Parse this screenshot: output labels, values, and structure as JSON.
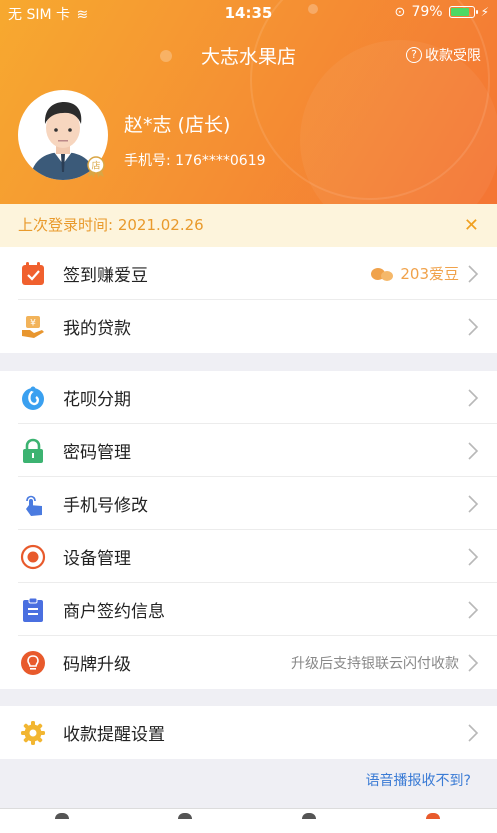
{
  "status_bar": {
    "carrier": "无 SIM 卡",
    "time": "14:35",
    "battery": "79%"
  },
  "header": {
    "title": "大志水果店",
    "limit_link": "收款受限",
    "user_name": "赵*志 (店长)",
    "user_phone": "手机号: 176****0619"
  },
  "notice": {
    "text": "上次登录时间: 2021.02.26",
    "close": "✕"
  },
  "group1": [
    {
      "label": "签到赚爱豆",
      "value": "203爱豆"
    },
    {
      "label": "我的贷款"
    }
  ],
  "group2": [
    {
      "label": "花呗分期"
    },
    {
      "label": "密码管理"
    },
    {
      "label": "手机号修改"
    },
    {
      "label": "设备管理"
    },
    {
      "label": "商户签约信息"
    },
    {
      "label": "码牌升级",
      "value": "升级后支持银联云闪付收款"
    }
  ],
  "group3": [
    {
      "label": "收款提醒设置"
    }
  ],
  "help_link": "语音播报收不到?",
  "colors": {
    "accent": "#f59233",
    "link": "#3a7bd5",
    "bean": "#f0a24b"
  }
}
